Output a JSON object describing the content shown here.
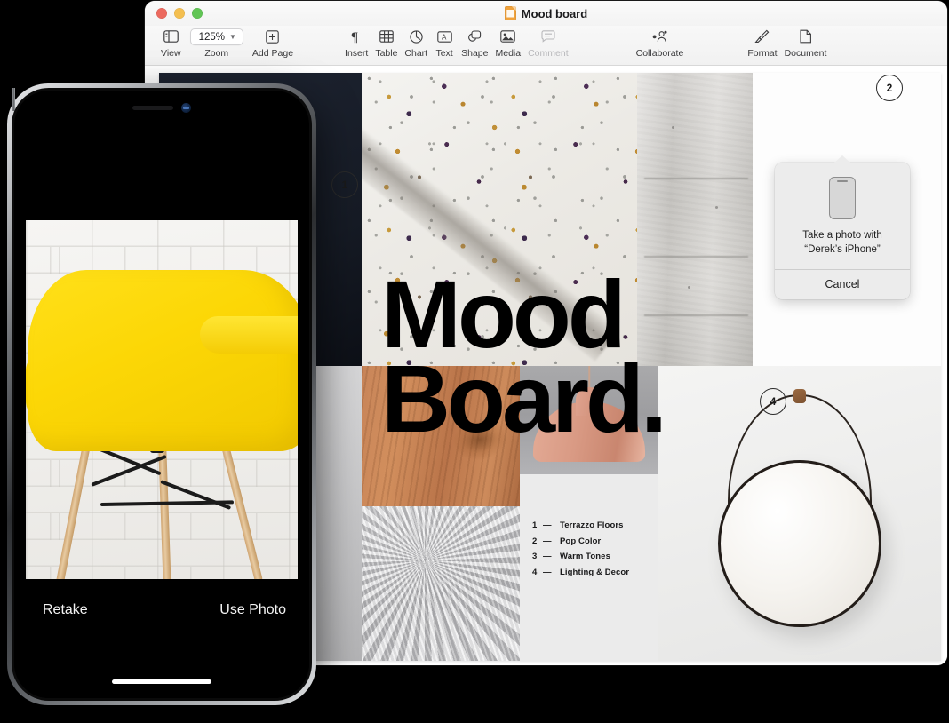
{
  "window": {
    "title": "Mood board",
    "app_icon": "pages-document-icon",
    "traffic_lights": [
      "close",
      "minimize",
      "zoom"
    ]
  },
  "toolbar": {
    "left_group": [
      {
        "id": "view",
        "label": "View",
        "icon": "sidebar-icon",
        "disabled": false
      },
      {
        "id": "zoom",
        "label": "Zoom",
        "value": "125%",
        "icon": "chevron-down-icon",
        "disabled": false
      },
      {
        "id": "add-page",
        "label": "Add Page",
        "icon": "plus-square-icon",
        "disabled": false
      }
    ],
    "insert_group": [
      {
        "id": "insert",
        "label": "Insert",
        "icon": "pilcrow-icon",
        "disabled": false
      },
      {
        "id": "table",
        "label": "Table",
        "icon": "table-grid-icon",
        "disabled": false
      },
      {
        "id": "chart",
        "label": "Chart",
        "icon": "pie-chart-icon",
        "disabled": false
      },
      {
        "id": "text",
        "label": "Text",
        "icon": "text-box-icon",
        "disabled": false
      },
      {
        "id": "shape",
        "label": "Shape",
        "icon": "shapes-icon",
        "disabled": false
      },
      {
        "id": "media",
        "label": "Media",
        "icon": "photo-icon",
        "disabled": false
      },
      {
        "id": "comment",
        "label": "Comment",
        "icon": "speech-bubble-icon",
        "disabled": true
      }
    ],
    "collaborate": {
      "id": "collaborate",
      "label": "Collaborate",
      "icon": "person-share-icon"
    },
    "right_group": [
      {
        "id": "format",
        "label": "Format",
        "icon": "paintbrush-icon"
      },
      {
        "id": "document",
        "label": "Document",
        "icon": "document-page-icon"
      }
    ]
  },
  "document": {
    "headline_line1": "Mood",
    "headline_line2": "Board.",
    "legend": [
      {
        "num": "1",
        "dash": "—",
        "label": "Terrazzo Floors"
      },
      {
        "num": "2",
        "dash": "—",
        "label": "Pop Color"
      },
      {
        "num": "3",
        "dash": "—",
        "label": "Warm Tones"
      },
      {
        "num": "4",
        "dash": "—",
        "label": "Lighting & Decor"
      }
    ],
    "callouts": [
      {
        "num": "1",
        "name": "callout-badge-1"
      },
      {
        "num": "2",
        "name": "callout-badge-2"
      },
      {
        "num": "4",
        "name": "callout-badge-4"
      }
    ]
  },
  "popover": {
    "icon": "iphone-glyph",
    "message_line1": "Take a photo with",
    "message_line2": "“Derek’s iPhone”",
    "cancel_label": "Cancel"
  },
  "iphone": {
    "retake_label": "Retake",
    "use_photo_label": "Use Photo",
    "photo_subject": "yellow-molded-armchair-against-white-brick-wall"
  },
  "colors": {
    "accent_yellow": "#fcd706",
    "window_chrome": "#f4f4f4",
    "popover_bg": "#ececec",
    "page_bg": "#ffffff",
    "desktop_bg": "#000000"
  }
}
